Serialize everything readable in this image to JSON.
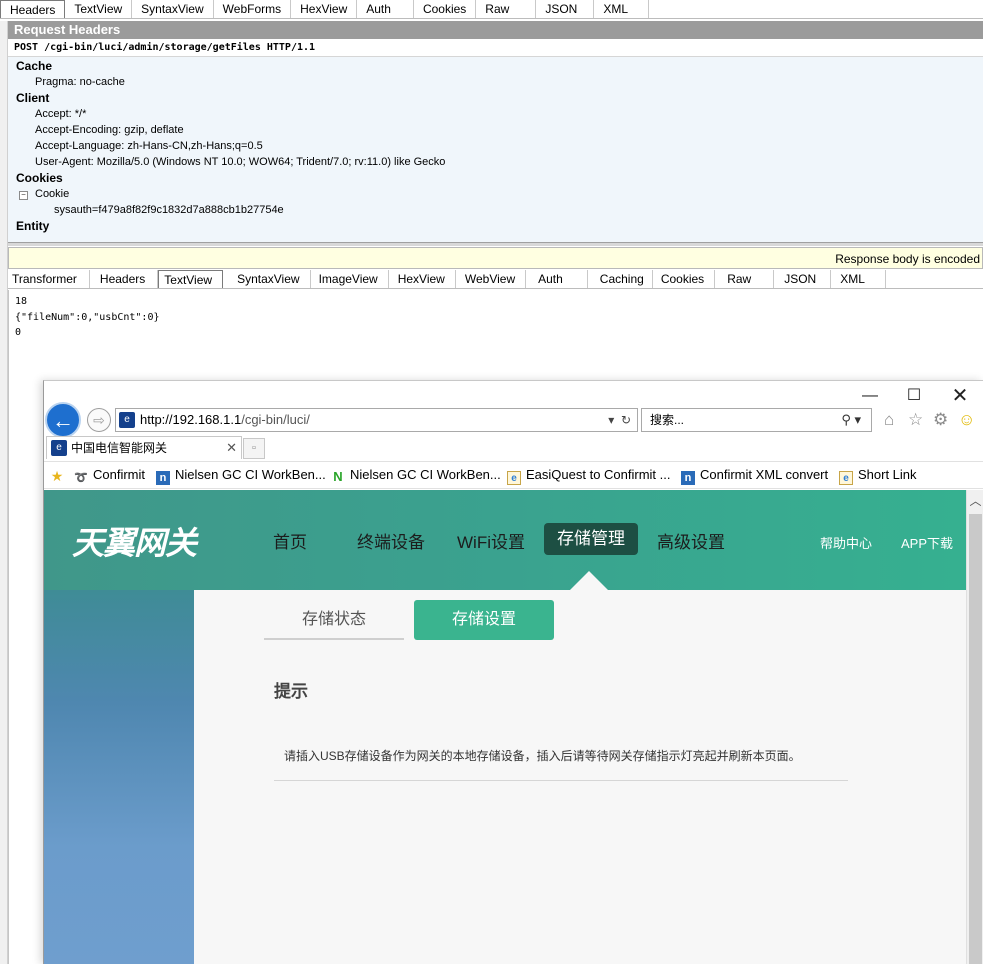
{
  "fiddler": {
    "request_tabs": [
      "Headers",
      "TextView",
      "SyntaxView",
      "WebForms",
      "HexView",
      "Auth",
      "Cookies",
      "Raw",
      "JSON",
      "XML"
    ],
    "request_headers_title": "Request Headers",
    "request_line": "POST /cgi-bin/luci/admin/storage/getFiles HTTP/1.1",
    "groups": {
      "cache": "Cache",
      "client": "Client",
      "cookies": "Cookies",
      "entity": "Entity"
    },
    "headers": {
      "pragma": "Pragma: no-cache",
      "accept": "Accept: */*",
      "accept_encoding": "Accept-Encoding: gzip, deflate",
      "accept_language": "Accept-Language: zh-Hans-CN,zh-Hans;q=0.5",
      "user_agent": "User-Agent: Mozilla/5.0 (Windows NT 10.0; WOW64; Trident/7.0; rv:11.0) like Gecko",
      "cookie": "Cookie",
      "sysauth": "sysauth=f479a8f82f9c1832d7a888cb1b27754e"
    },
    "encoded_notice": "Response body is encoded",
    "response_tabs": [
      "Transformer",
      "Headers",
      "TextView",
      "SyntaxView",
      "ImageView",
      "HexView",
      "WebView",
      "Auth",
      "Caching",
      "Cookies",
      "Raw",
      "JSON",
      "XML"
    ],
    "response_body": [
      "18",
      "{\"fileNum\":0,\"usbCnt\":0}",
      "0"
    ]
  },
  "ie": {
    "url_host": "http://192.168.1.1",
    "url_path": "/cgi-bin/luci/",
    "search_placeholder": "搜索...",
    "tab_title": "中国电信智能网关",
    "favorites": [
      "Confirmit",
      "Nielsen GC CI WorkBen...",
      "Nielsen GC CI WorkBen...",
      "EasiQuest to Confirmit ...",
      "Confirmit XML convert",
      "Short Link"
    ]
  },
  "router": {
    "logo": "天翼网关",
    "nav": [
      "首页",
      "终端设备",
      "WiFi设置",
      "存储管理",
      "高级设置"
    ],
    "nav_right": [
      "帮助中心",
      "APP下载"
    ],
    "subtabs": [
      "存储状态",
      "存储设置"
    ],
    "tip_title": "提示",
    "tip_text": "请插入USB存储设备作为网关的本地存储设备，插入后请等待网关存储指示灯亮起并刷新本页面。"
  },
  "colors": {
    "active_nav": "#1d4f43",
    "active_subtab": "#3ab48f",
    "header_gradient_start": "#40978a",
    "ie_back_button": "#1e6fcf"
  }
}
